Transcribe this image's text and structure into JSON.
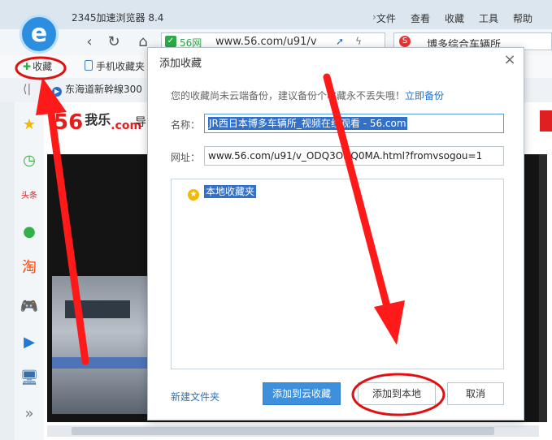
{
  "browser": {
    "title": "2345加速浏览器 8.4",
    "menu": [
      "文件",
      "查看",
      "收藏",
      "工具",
      "帮助"
    ],
    "logo_letter": "e",
    "address": {
      "site_tag": "56网",
      "url": "www.56.com/u91/v"
    },
    "search": {
      "icon_text": "S",
      "value": "博多综合车辆所"
    },
    "bookmarks_bar": {
      "favorites_label": "收藏",
      "mobile_label": "手机收藏夹"
    },
    "tab": {
      "title": "东海道新幹線300"
    }
  },
  "page": {
    "logo": {
      "main": "56",
      "sub": "我乐",
      "dotcom": ".com"
    },
    "nav_fragment": "导"
  },
  "sidebar": [
    {
      "icon": "star-icon",
      "glyph": "★",
      "color": "#f5b800"
    },
    {
      "icon": "clock-icon",
      "glyph": "◷",
      "color": "#3aa845"
    },
    {
      "icon": "news-icon",
      "glyph": "头条",
      "color": "#e02020"
    },
    {
      "icon": "chat-icon",
      "glyph": "●",
      "color": "#32b04a"
    },
    {
      "icon": "taobao-icon",
      "glyph": "淘",
      "color": "#ff4400"
    },
    {
      "icon": "gamepad-icon",
      "glyph": "🎮",
      "color": "#555555"
    },
    {
      "icon": "video-icon",
      "glyph": "▶",
      "color": "#1e7ad4"
    },
    {
      "icon": "computer-icon",
      "glyph": "🖥",
      "color": "#3a6ea5"
    },
    {
      "icon": "more-icon",
      "glyph": "»",
      "color": "#777777"
    }
  ],
  "dialog": {
    "title": "添加收藏",
    "close": "×",
    "notice": "您的收藏尚未云端备份，建议备份个",
    "notice_tail": "收藏永不丢失哦！",
    "notice_link": "立即备份",
    "name_label": "名称：",
    "name_value": "JR西日本博多车辆所_视频在线观看 - 56.com",
    "url_label": "网址：",
    "url_value": "www.56.com/u91/v_ODQ3ODQ0MA.html?fromvsogou=1",
    "folder": "本地收藏夹",
    "new_folder": "新建文件夹",
    "btn_cloud": "添加到云收藏",
    "btn_local": "添加到本地",
    "btn_cancel": "取消"
  },
  "colors": {
    "accent_blue": "#3e90dd",
    "annotation_red": "#ff1a1a",
    "brand_red": "#e02020"
  }
}
